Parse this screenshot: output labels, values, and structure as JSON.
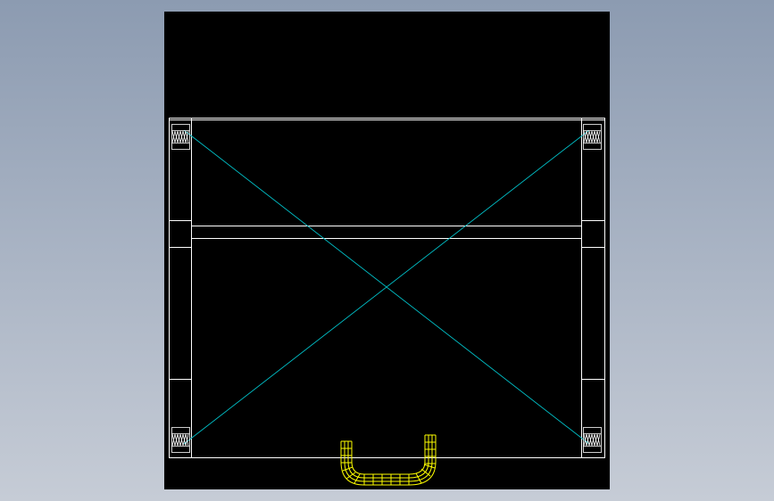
{
  "canvas": {
    "background_color": "#000000",
    "page_background": "#a3afc0"
  },
  "drawing": {
    "view": "front",
    "colors": {
      "outline": "#ffffff",
      "diagonals": "#00c0c8",
      "handle": "#ffff00"
    },
    "elements": [
      "outer-frame",
      "left-post",
      "right-post",
      "horizontal-rail",
      "cross-diagonals",
      "spring-symbols",
      "handle"
    ]
  }
}
